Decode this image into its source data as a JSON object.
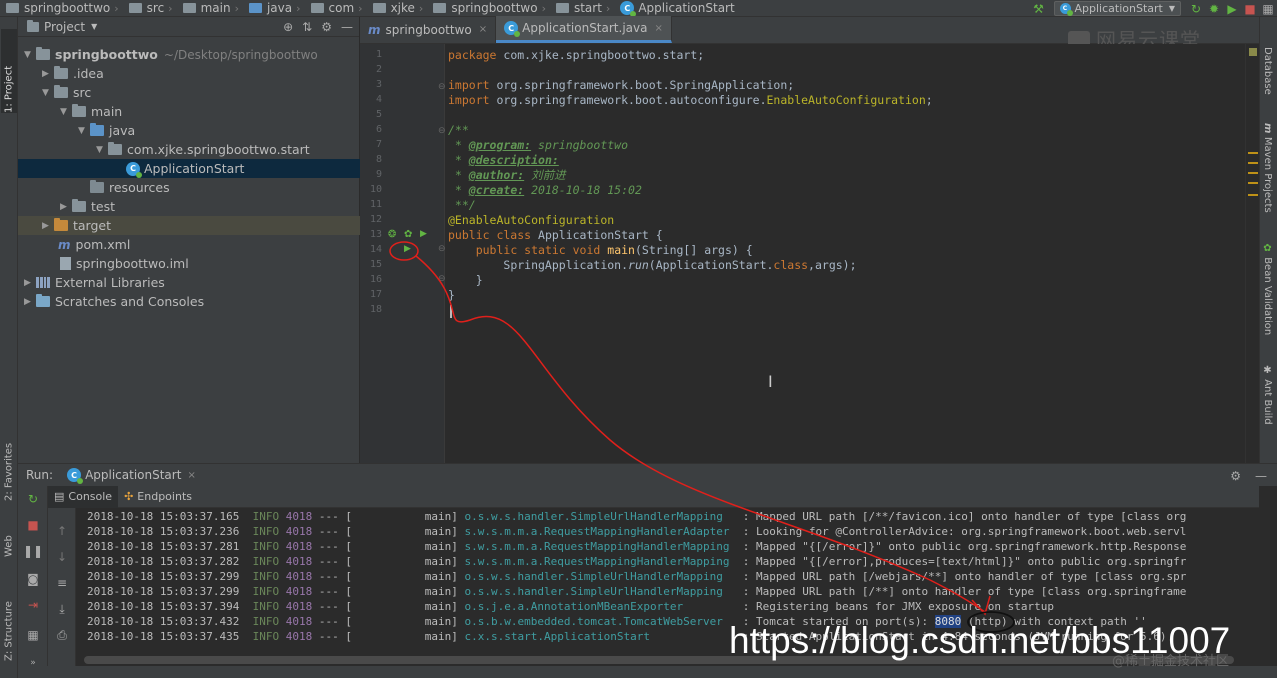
{
  "navbar": {
    "crumbs": [
      "springboottwo",
      "src",
      "main",
      "java",
      "com",
      "xjke",
      "springboottwo",
      "start",
      "ApplicationStart"
    ],
    "run_config": "ApplicationStart"
  },
  "project": {
    "title": "Project",
    "tree": [
      {
        "label": "springboottwo",
        "extra": "~/Desktop/springboottwo"
      },
      {
        "label": ".idea"
      },
      {
        "label": "src"
      },
      {
        "label": "main"
      },
      {
        "label": "java"
      },
      {
        "label": "com.xjke.springboottwo.start"
      },
      {
        "label": "ApplicationStart"
      },
      {
        "label": "resources"
      },
      {
        "label": "test"
      },
      {
        "label": "target"
      },
      {
        "label": "pom.xml"
      },
      {
        "label": "springboottwo.iml"
      },
      {
        "label": "External Libraries"
      },
      {
        "label": "Scratches and Consoles"
      }
    ]
  },
  "editor": {
    "tabs": [
      "springboottwo",
      "ApplicationStart.java"
    ],
    "watermark": "网易云课堂",
    "line_numbers": [
      "1",
      "2",
      "3",
      "4",
      "5",
      "6",
      "7",
      "8",
      "9",
      "10",
      "11",
      "12",
      "13",
      "14",
      "15",
      "16",
      "17",
      "18"
    ],
    "code": {
      "l1_kw": "package",
      "l1_rest": " com.xjke.springboottwo.start;",
      "l3_kw": "import",
      "l3_rest": " org.springframework.boot.SpringApplication;",
      "l4_kw": "import",
      "l4_rest": " org.springframework.boot.autoconfigure.",
      "l4_ann": "EnableAutoConfiguration",
      "l4_end": ";",
      "l6": "/**",
      "l7_tag": "@program:",
      "l7_val": " springboottwo",
      "l8_tag": "@description:",
      "l9_tag": "@author:",
      "l9_val": " 刘前进",
      "l10_tag": "@create:",
      "l10_val": " 2018-10-18 15:02",
      "l11": " **/",
      "l12": "@EnableAutoConfiguration",
      "l13_kw": "public class",
      "l13_rest": " ApplicationStart {",
      "l14_kw": "public static void",
      "l14_fn": "main",
      "l14_rest": "(String[] args) {",
      "l15_a": "SpringApplication.",
      "l15_run": "run",
      "l15_b": "(ApplicationStart.",
      "l15_kw": "class",
      "l15_c": ",args);",
      "l16": "}",
      "l17": "}"
    }
  },
  "right_tools": [
    "Database",
    "Maven Projects",
    "Bean Validation",
    "Ant Build"
  ],
  "left_tools": [
    "1: Project",
    "2: Favorites",
    "Web",
    "Z: Structure"
  ],
  "run": {
    "label": "Run:",
    "tab": "ApplicationStart",
    "subtabs": [
      "Console",
      "Endpoints"
    ],
    "log": [
      {
        "ts": "2018-10-18 15:03:37.165",
        "lvl": "INFO",
        "pid": "4018",
        "sep": " --- [",
        "thread": "           main]",
        "logger": "o.s.w.s.handler.SimpleUrlHandlerMapping  ",
        "msg": " : Mapped URL path [/**/favicon.ico] onto handler of type [class org"
      },
      {
        "ts": "2018-10-18 15:03:37.236",
        "lvl": "INFO",
        "pid": "4018",
        "sep": " --- [",
        "thread": "           main]",
        "logger": "s.w.s.m.m.a.RequestMappingHandlerAdapter ",
        "msg": " : Looking for @ControllerAdvice: org.springframework.boot.web.servl"
      },
      {
        "ts": "2018-10-18 15:03:37.281",
        "lvl": "INFO",
        "pid": "4018",
        "sep": " --- [",
        "thread": "           main]",
        "logger": "s.w.s.m.m.a.RequestMappingHandlerMapping ",
        "msg": " : Mapped \"{[/error]}\" onto public org.springframework.http.Response"
      },
      {
        "ts": "2018-10-18 15:03:37.282",
        "lvl": "INFO",
        "pid": "4018",
        "sep": " --- [",
        "thread": "           main]",
        "logger": "s.w.s.m.m.a.RequestMappingHandlerMapping ",
        "msg": " : Mapped \"{[/error],produces=[text/html]}\" onto public org.springfr"
      },
      {
        "ts": "2018-10-18 15:03:37.299",
        "lvl": "INFO",
        "pid": "4018",
        "sep": " --- [",
        "thread": "           main]",
        "logger": "o.s.w.s.handler.SimpleUrlHandlerMapping  ",
        "msg": " : Mapped URL path [/webjars/**] onto handler of type [class org.spr"
      },
      {
        "ts": "2018-10-18 15:03:37.299",
        "lvl": "INFO",
        "pid": "4018",
        "sep": " --- [",
        "thread": "           main]",
        "logger": "o.s.w.s.handler.SimpleUrlHandlerMapping  ",
        "msg": " : Mapped URL path [/**] onto handler of type [class org.springframe"
      },
      {
        "ts": "2018-10-18 15:03:37.394",
        "lvl": "INFO",
        "pid": "4018",
        "sep": " --- [",
        "thread": "           main]",
        "logger": "o.s.j.e.a.AnnotationMBeanExporter        ",
        "msg": " : Registering beans for JMX exposure on startup"
      },
      {
        "ts": "2018-10-18 15:03:37.432",
        "lvl": "INFO",
        "pid": "4018",
        "sep": " --- [",
        "thread": "           main]",
        "logger": "o.s.b.w.embedded.tomcat.TomcatWebServer  ",
        "msg_a": " : Tomcat started on port(s): ",
        "port": "8080",
        "msg_b": " (http) with context path ''"
      },
      {
        "ts": "2018-10-18 15:03:37.435",
        "lvl": "INFO",
        "pid": "4018",
        "sep": " --- [",
        "thread": "           main]",
        "logger": "c.x.s.start.ApplicationStart             ",
        "msg": " : Started ApplicationStart in 4.84 seconds (JVM running for 5.6)"
      }
    ]
  },
  "watermarks": {
    "url": "https://blog.csdn.net/bbs11007",
    "cn": "@稀土掘金技术社区"
  },
  "colors": {
    "annotation_ink": "#e0201b",
    "accent": "#4a88c7"
  }
}
